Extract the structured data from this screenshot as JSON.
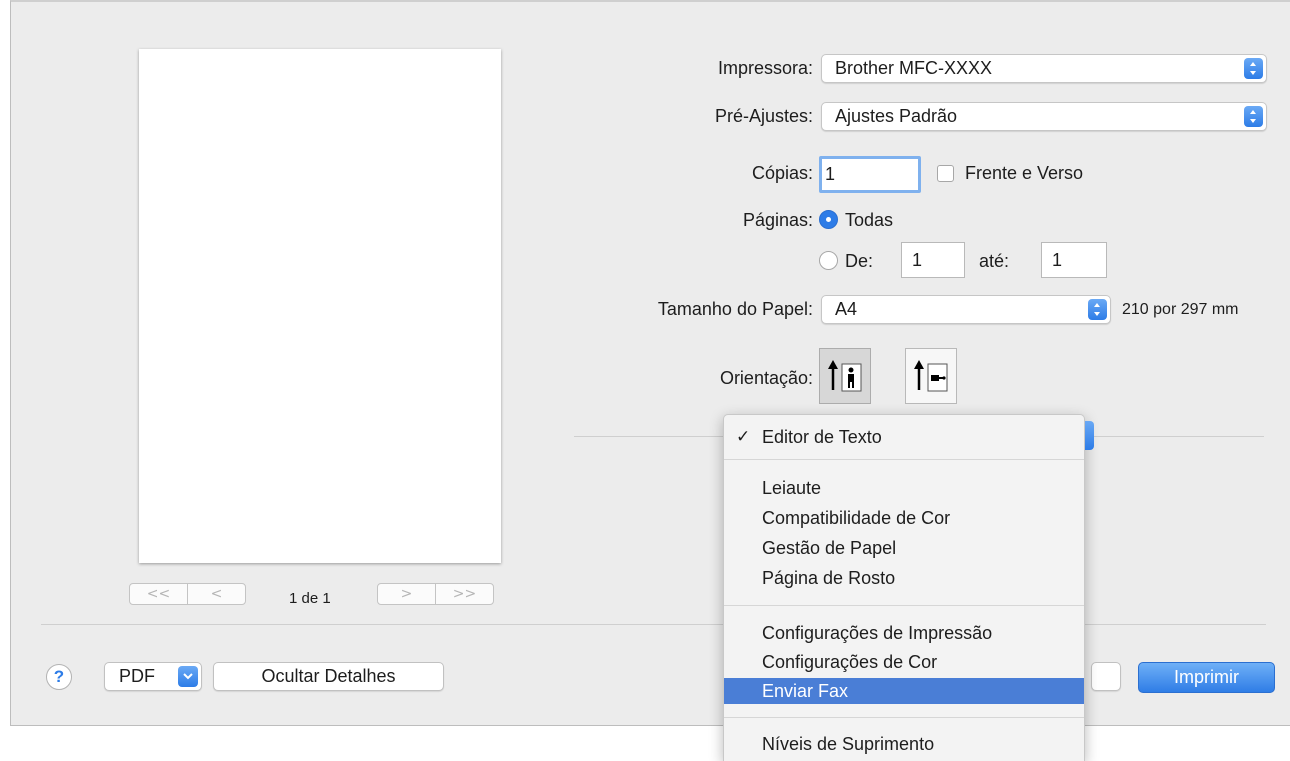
{
  "preview": {
    "first_label": "<<",
    "prev_label": "<",
    "next_label": ">",
    "last_label": ">>",
    "counter": "1 de 1"
  },
  "printer": {
    "label": "Impressora:",
    "value": "Brother MFC-XXXX"
  },
  "presets": {
    "label": "Pré-Ajustes:",
    "value": "Ajustes Padrão"
  },
  "copies": {
    "label": "Cópias:",
    "value": "1",
    "duplex_label": "Frente e Verso",
    "duplex_checked": false
  },
  "pages": {
    "label": "Páginas:",
    "all_label": "Todas",
    "all_selected": true,
    "from_label": "De:",
    "from_value": "1",
    "to_label": "até:",
    "to_value": "1"
  },
  "paper_size": {
    "label": "Tamanho do Papel:",
    "value": "A4",
    "dimensions": "210 por 297 mm"
  },
  "orientation": {
    "label": "Orientação:",
    "selected": "portrait",
    "icons": [
      "portrait-orientation-icon",
      "landscape-orientation-icon"
    ]
  },
  "section_menu": {
    "checked_item": "Editor de Texto",
    "groups": [
      [
        "Leiaute",
        "Compatibilidade de Cor",
        "Gestão de Papel",
        "Página de Rosto"
      ],
      [
        "Configurações de Impressão",
        "Configurações de Cor",
        "Enviar Fax"
      ],
      [
        "Níveis de Suprimento"
      ]
    ],
    "highlighted_item": "Enviar Fax"
  },
  "footer": {
    "help_label": "?",
    "pdf_label": "PDF",
    "hide_details_label": "Ocultar Detalhes",
    "print_label": "Imprimir"
  },
  "colors": {
    "accent": "#2d7ce7",
    "menu_highlight": "#4a7ed6"
  }
}
